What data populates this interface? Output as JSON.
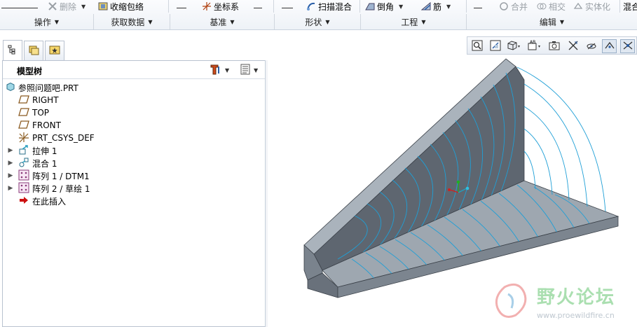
{
  "ribbon": {
    "buttons": {
      "delete": "删除",
      "shrinkwrap": "收缩包络",
      "csys": "坐标系",
      "sweep_blend": "扫描混合",
      "round": "倒角",
      "rib": "筋",
      "merge": "合并",
      "intersect": "相交",
      "solidify": "实体化",
      "blend_cut": "混合"
    },
    "groups": {
      "operations": "操作",
      "get_data": "获取数据",
      "datum": "基准",
      "shapes": "形状",
      "engineering": "工程",
      "editing": "编辑"
    }
  },
  "model_tree": {
    "title": "模型树",
    "items": [
      {
        "label": "参照问题吧.PRT"
      },
      {
        "label": "RIGHT"
      },
      {
        "label": "TOP"
      },
      {
        "label": "FRONT"
      },
      {
        "label": "PRT_CSYS_DEF"
      },
      {
        "label": "拉伸 1"
      },
      {
        "label": "混合 1"
      },
      {
        "label": "阵列 1 / DTM1"
      },
      {
        "label": "阵列 2 / 草绘 1"
      },
      {
        "label": "在此插入"
      }
    ]
  },
  "watermark": {
    "site_name": "野火论坛",
    "url": "www.proewildfire.cn"
  },
  "colors": {
    "model_dark": "#5e6670",
    "model_light": "#9ea7b0",
    "curve": "#1f9fd6",
    "insert_arrow": "#cc1010"
  }
}
